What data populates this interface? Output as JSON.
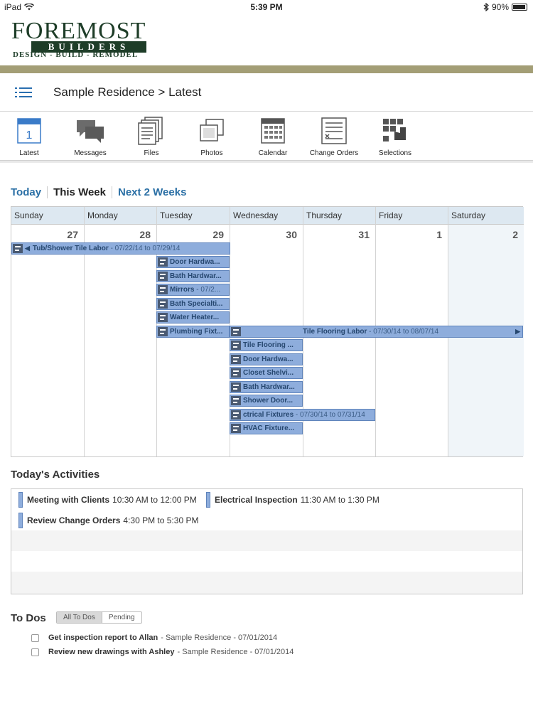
{
  "status_bar": {
    "device": "iPad",
    "time": "5:39 PM",
    "battery": "90%",
    "battery_level": 0.9
  },
  "logo": {
    "main": "FOREMOST",
    "sub": "BUILDERS",
    "tagline": "DESIGN - BUILD - REMODEL"
  },
  "header": {
    "breadcrumb": "Sample Residence > Latest"
  },
  "toolbar": {
    "latest": {
      "label": "Latest",
      "badge": "1"
    },
    "messages": "Messages",
    "files": "Files",
    "photos": "Photos",
    "calendar": "Calendar",
    "change_orders": "Change Orders",
    "selections": "Selections"
  },
  "tabs": {
    "today": "Today",
    "this_week": "This Week",
    "next_2_weeks": "Next 2 Weeks"
  },
  "calendar": {
    "days": [
      {
        "name": "Sunday",
        "num": "27"
      },
      {
        "name": "Monday",
        "num": "28"
      },
      {
        "name": "Tuesday",
        "num": "29"
      },
      {
        "name": "Wednesday",
        "num": "30"
      },
      {
        "name": "Thursday",
        "num": "31"
      },
      {
        "name": "Friday",
        "num": "1"
      },
      {
        "name": "Saturday",
        "num": "2"
      }
    ],
    "events": [
      {
        "title": "Tub/Shower Tile Labor",
        "dates": " - 07/22/14 to 07/29/14"
      },
      {
        "title": "Door Hardwa..."
      },
      {
        "title": "Bath Hardwar..."
      },
      {
        "title": "Mirrors",
        "dates": " - 07/2..."
      },
      {
        "title": "Bath Specialti..."
      },
      {
        "title": "Water Heater..."
      },
      {
        "title": "Plumbing Fixt..."
      },
      {
        "title": "Tile Flooring Labor",
        "dates": " - 07/30/14 to 08/07/14"
      },
      {
        "title": "Tile Flooring ..."
      },
      {
        "title": "Door Hardwa..."
      },
      {
        "title": "Closet Shelvi..."
      },
      {
        "title": "Bath Hardwar..."
      },
      {
        "title": "Shower Door..."
      },
      {
        "title": "ctrical Fixtures",
        "dates": " - 07/30/14 to 07/31/14"
      },
      {
        "title": "HVAC Fixture..."
      }
    ]
  },
  "activities": {
    "title": "Today's Activities",
    "items": [
      {
        "name": "Meeting with Clients",
        "time": "10:30 AM to 12:00 PM"
      },
      {
        "name": "Electrical Inspection",
        "time": "11:30 AM to 1:30 PM"
      },
      {
        "name": "Review Change Orders",
        "time": "4:30 PM to 5:30 PM"
      }
    ]
  },
  "todos": {
    "title": "To Dos",
    "filters": {
      "all": "All To Dos",
      "pending": "Pending"
    },
    "items": [
      {
        "task": "Get inspection report to Allan",
        "detail": " - Sample Residence - 07/01/2014"
      },
      {
        "task": "Review new drawings with Ashley",
        "detail": " - Sample Residence - 07/01/2014"
      }
    ]
  },
  "colors": {
    "accent": "#2a6fa5",
    "event": "#8eaddc",
    "olive": "#a39e76",
    "logo": "#1e3d28"
  }
}
